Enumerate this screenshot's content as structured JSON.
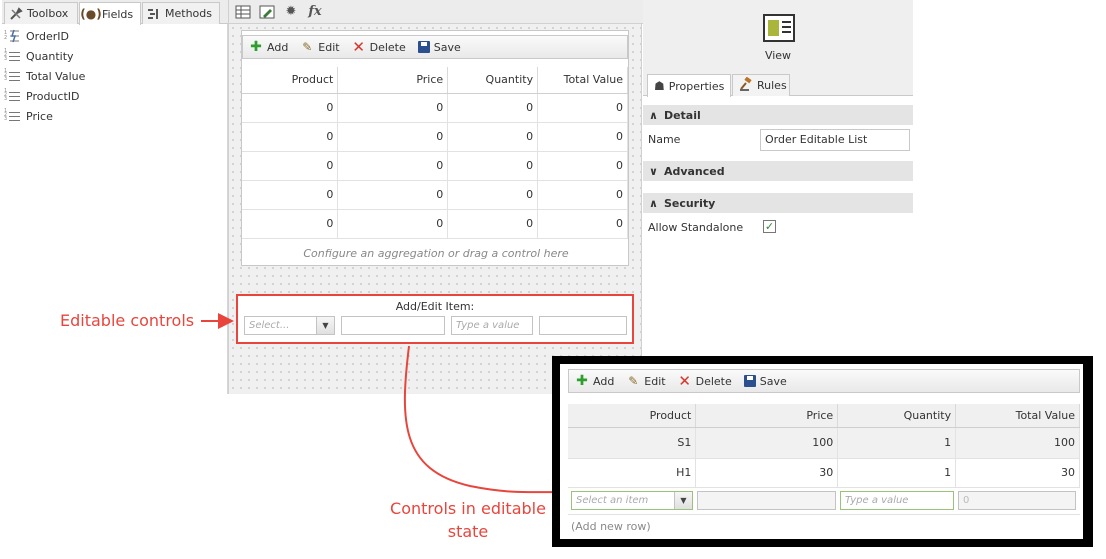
{
  "left_panel": {
    "tabs": [
      {
        "label": "Toolbox",
        "icon": "wrench-icon"
      },
      {
        "label": "Fields",
        "icon": "braces-icon"
      },
      {
        "label": "Methods",
        "icon": "methods-icon"
      }
    ],
    "active_tab": "Fields",
    "fields": [
      {
        "label": "OrderID",
        "icon": "autonumber-field-icon"
      },
      {
        "label": "Quantity",
        "icon": "number-field-icon"
      },
      {
        "label": "Total Value",
        "icon": "number-field-icon"
      },
      {
        "label": "ProductID",
        "icon": "number-field-icon"
      },
      {
        "label": "Price",
        "icon": "number-field-icon"
      }
    ]
  },
  "canvas": {
    "toolbar_icons": [
      "list-view-icon",
      "edit-view-icon",
      "gear-icon",
      "fx-icon"
    ],
    "fx_label": "fx",
    "list_toolbar": {
      "add": "Add",
      "edit": "Edit",
      "delete": "Delete",
      "save": "Save"
    },
    "columns": [
      "Product",
      "Price",
      "Quantity",
      "Total Value"
    ],
    "rows": [
      [
        "0",
        "0",
        "0",
        "0"
      ],
      [
        "0",
        "0",
        "0",
        "0"
      ],
      [
        "0",
        "0",
        "0",
        "0"
      ],
      [
        "0",
        "0",
        "0",
        "0"
      ],
      [
        "0",
        "0",
        "0",
        "0"
      ]
    ],
    "aggregation_hint": "Configure an aggregation or drag a control here",
    "add_edit": {
      "title": "Add/Edit Item:",
      "select_placeholder": "Select...",
      "text_placeholder": "Type a value"
    }
  },
  "right_panel": {
    "view_label": "View",
    "tabs": [
      {
        "label": "Properties",
        "icon": "properties-icon"
      },
      {
        "label": "Rules",
        "icon": "rules-gavel-icon"
      }
    ],
    "sections": {
      "detail": "Detail",
      "advanced": "Advanced",
      "security": "Security"
    },
    "name_label": "Name",
    "name_value": "Order Editable List",
    "allow_standalone_label": "Allow Standalone",
    "allow_standalone_checked": true
  },
  "annotations": {
    "editable_controls": "Editable controls",
    "controls_editable_line1": "Controls in editable",
    "controls_editable_line2": "state",
    "color": "#e8453c"
  },
  "inset": {
    "list_toolbar": {
      "add": "Add",
      "edit": "Edit",
      "delete": "Delete",
      "save": "Save"
    },
    "columns": [
      "Product",
      "Price",
      "Quantity",
      "Total Value"
    ],
    "rows": [
      [
        "S1",
        "100",
        "1",
        "100"
      ],
      [
        "H1",
        "30",
        "1",
        "30"
      ]
    ],
    "select_placeholder": "Select an item",
    "text_placeholder": "Type a value",
    "total_value_placeholder": "0",
    "add_new_row": "(Add new row)"
  }
}
